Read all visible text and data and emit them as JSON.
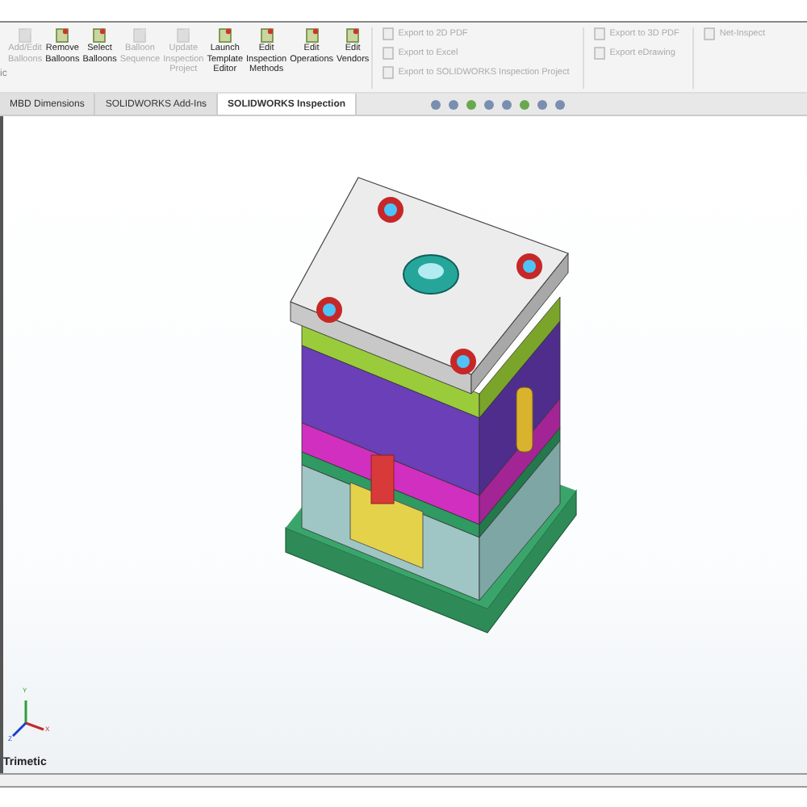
{
  "toolbar": {
    "cut_label": "ic",
    "buttons": [
      {
        "lines": [
          "Add/Edit",
          "Balloons"
        ],
        "disabled": true
      },
      {
        "lines": [
          "Remove",
          "Balloons"
        ],
        "disabled": false
      },
      {
        "lines": [
          "Select",
          "Balloons"
        ],
        "disabled": false
      },
      {
        "lines": [
          "Balloon",
          "Sequence"
        ],
        "disabled": true
      },
      {
        "lines": [
          "Update",
          "Inspection",
          "Project"
        ],
        "disabled": true
      },
      {
        "lines": [
          "Launch",
          "Template",
          "Editor"
        ],
        "disabled": false
      },
      {
        "lines": [
          "Edit",
          "Inspection",
          "Methods"
        ],
        "disabled": false
      },
      {
        "lines": [
          "Edit",
          "Operations"
        ],
        "disabled": false
      },
      {
        "lines": [
          "Edit",
          "Vendors"
        ],
        "disabled": false
      }
    ],
    "export_columns": [
      [
        {
          "label": "Export to 2D PDF",
          "disabled": true
        },
        {
          "label": "Export to Excel",
          "disabled": true
        },
        {
          "label": "Export to SOLIDWORKS Inspection Project",
          "disabled": true
        }
      ],
      [
        {
          "label": "Export to 3D PDF",
          "disabled": true
        },
        {
          "label": "Export eDrawing",
          "disabled": true
        }
      ],
      [
        {
          "label": "Net-Inspect",
          "disabled": true
        }
      ]
    ]
  },
  "tabs": [
    {
      "label": "MBD Dimensions",
      "selected": false
    },
    {
      "label": "SOLIDWORKS Add-Ins",
      "selected": false
    },
    {
      "label": "SOLIDWORKS Inspection",
      "selected": true
    }
  ],
  "viewport": {
    "axes": [
      "Y",
      "X",
      "Z"
    ],
    "view_name": "Trimetic"
  }
}
